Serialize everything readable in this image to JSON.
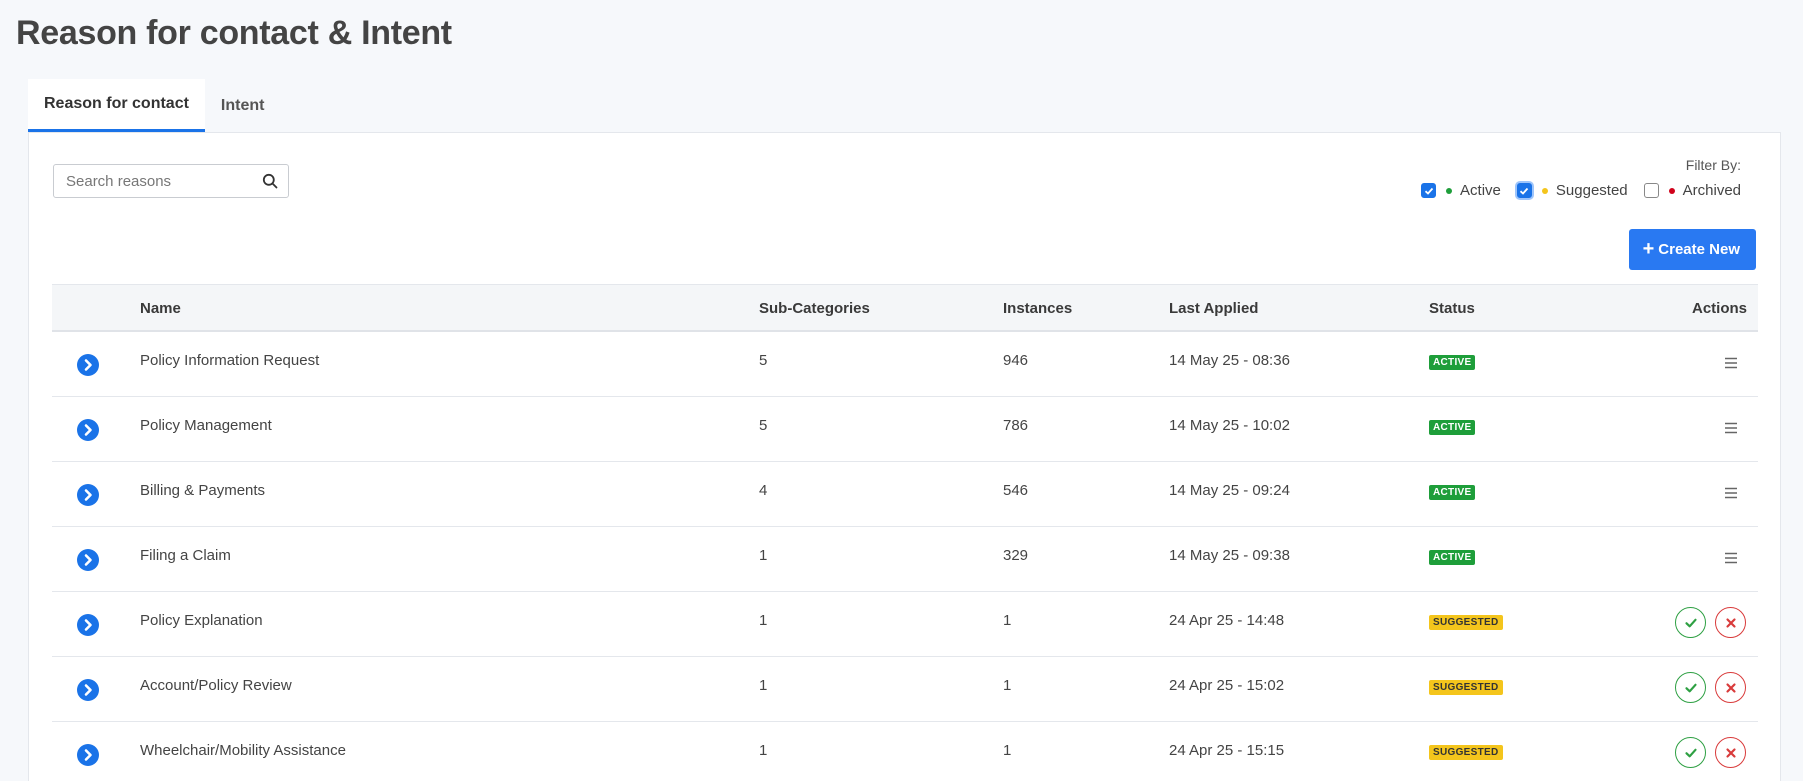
{
  "page": {
    "title": "Reason for contact & Intent"
  },
  "tabs": [
    {
      "label": "Reason for contact",
      "active": true
    },
    {
      "label": "Intent",
      "active": false
    }
  ],
  "search": {
    "placeholder": "Search reasons",
    "value": ""
  },
  "filter": {
    "label": "Filter By:",
    "options": [
      {
        "label": "Active",
        "checked": true,
        "dot_color": "#1e9e3a"
      },
      {
        "label": "Suggested",
        "checked": true,
        "dot_color": "#f4c51c"
      },
      {
        "label": "Archived",
        "checked": false,
        "dot_color": "#d0021b"
      }
    ]
  },
  "create_button": {
    "icon": "plus-icon",
    "label": "Create New"
  },
  "table": {
    "columns": {
      "name": "Name",
      "subcategories": "Sub-Categories",
      "instances": "Instances",
      "last_applied": "Last Applied",
      "status": "Status",
      "actions": "Actions"
    },
    "rows": [
      {
        "name": "Policy Information Request",
        "subcategories": "5",
        "instances": "946",
        "last_applied": "14 May 25 - 08:36",
        "status": "ACTIVE",
        "status_type": "active"
      },
      {
        "name": "Policy Management",
        "subcategories": "5",
        "instances": "786",
        "last_applied": "14 May 25 - 10:02",
        "status": "ACTIVE",
        "status_type": "active"
      },
      {
        "name": "Billing & Payments",
        "subcategories": "4",
        "instances": "546",
        "last_applied": "14 May 25 - 09:24",
        "status": "ACTIVE",
        "status_type": "active"
      },
      {
        "name": "Filing a Claim",
        "subcategories": "1",
        "instances": "329",
        "last_applied": "14 May 25 - 09:38",
        "status": "ACTIVE",
        "status_type": "active"
      },
      {
        "name": "Policy Explanation",
        "subcategories": "1",
        "instances": "1",
        "last_applied": "24 Apr 25 - 14:48",
        "status": "SUGGESTED",
        "status_type": "suggested"
      },
      {
        "name": "Account/Policy Review",
        "subcategories": "1",
        "instances": "1",
        "last_applied": "24 Apr 25 - 15:02",
        "status": "SUGGESTED",
        "status_type": "suggested"
      },
      {
        "name": "Wheelchair/Mobility Assistance",
        "subcategories": "1",
        "instances": "1",
        "last_applied": "24 Apr 25 - 15:15",
        "status": "SUGGESTED",
        "status_type": "suggested"
      }
    ]
  },
  "colors": {
    "accent": "#1a73e8",
    "primary_button": "#2979f2",
    "active": "#1e9e3a",
    "suggested": "#f4c51c",
    "reject": "#d93b3b"
  }
}
